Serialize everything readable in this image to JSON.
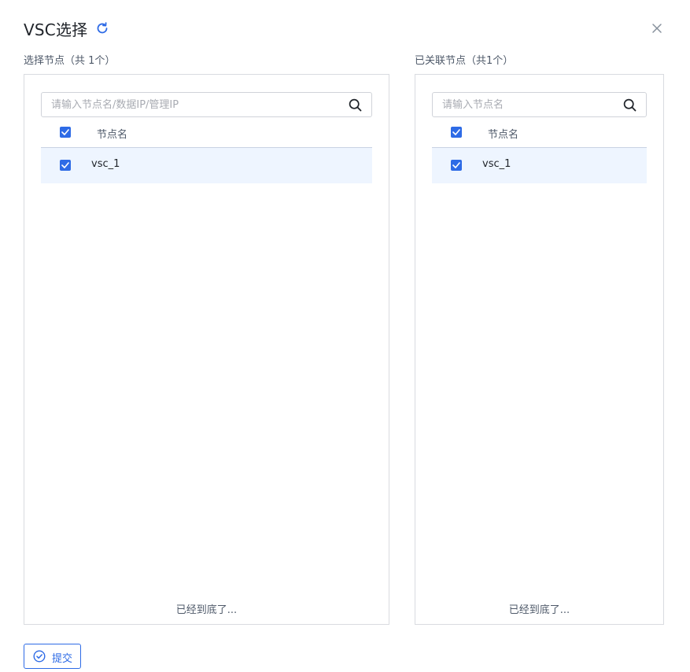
{
  "dialog": {
    "title": "VSC选择",
    "icons": {
      "refresh": "refresh-icon",
      "close": "close-icon"
    },
    "accent_color": "#2e6be6"
  },
  "left_panel": {
    "label": "选择节点（共 1个）",
    "search_placeholder": "请输入节点名/数据IP/管理IP",
    "search_value": "",
    "header_checked": true,
    "column_header": "节点名",
    "rows": [
      {
        "name": "vsc_1",
        "checked": true
      }
    ],
    "footer": "已经到底了..."
  },
  "right_panel": {
    "label": "已关联节点（共1个）",
    "search_placeholder": "请输入节点名",
    "search_value": "",
    "header_checked": true,
    "column_header": "节点名",
    "rows": [
      {
        "name": "vsc_1",
        "checked": true
      }
    ],
    "footer": "已经到底了..."
  },
  "actions": {
    "submit_label": "提交"
  }
}
